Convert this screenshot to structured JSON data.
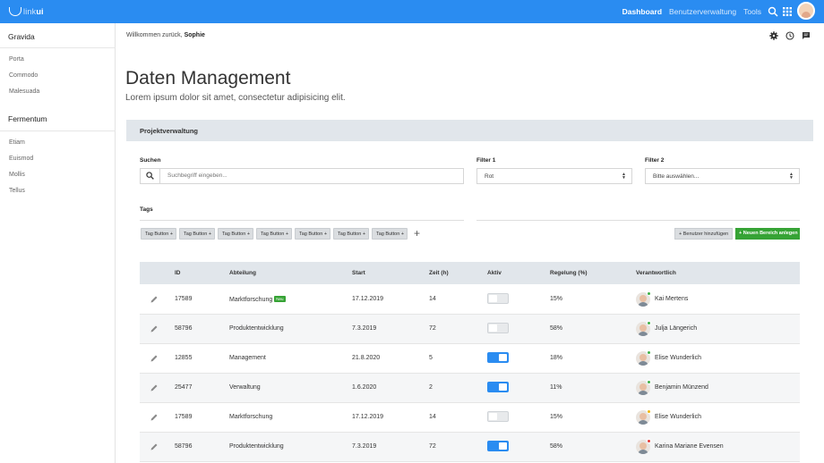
{
  "brand": {
    "prefix": "link",
    "suffix": "ui",
    "accent": "#2a8cf1"
  },
  "nav": {
    "dashboard": "Dashboard",
    "users": "Benutzerverwaltung",
    "tools": "Tools"
  },
  "sidebar": {
    "section1": "Gravida",
    "items1": [
      "Porta",
      "Commodo",
      "Malesuada"
    ],
    "section2": "Fermentum",
    "items2": [
      "Etiam",
      "Euismod",
      "Mollis",
      "Tellus"
    ]
  },
  "header": {
    "welcome": "Willkommen zurück,",
    "user": "Sophie"
  },
  "page": {
    "title": "Daten Management",
    "subtitle": "Lorem ipsum dolor sit amet, consectetur adipisicing elit."
  },
  "panel": {
    "title": "Projektverwaltung"
  },
  "filters": {
    "search_label": "Suchen",
    "search_placeholder": "Suchbegriff eingeben...",
    "filter1_label": "Filter 1",
    "filter1_value": "Rot",
    "filter2_label": "Filter 2",
    "filter2_value": "Bitte auswählen..."
  },
  "tags": {
    "label": "Tags",
    "items": [
      "Tag Button +",
      "Tag Button +",
      "Tag Button +",
      "Tag Button +",
      "Tag Button +",
      "Tag Button +",
      "Tag Button +"
    ],
    "add_user": "+ Benutzer hinzufügen",
    "new_area": "+ Neuen Bereich anlegen"
  },
  "table": {
    "headers": [
      "ID",
      "Abteilung",
      "Start",
      "Zeit (h)",
      "Aktiv",
      "Regelung (%)",
      "Verantwortlich"
    ],
    "badge_new": "Neu",
    "rows": [
      {
        "id": "17589",
        "dept": "Marktforschung",
        "start": "17.12.2019",
        "time": "14",
        "active": false,
        "reg": "15%",
        "person": "Kai Mertens",
        "status": "#3cb043"
      },
      {
        "id": "58796",
        "dept": "Produktentwicklung",
        "start": "7.3.2019",
        "time": "72",
        "active": false,
        "reg": "58%",
        "person": "Julja Längerich",
        "status": "#3cb043"
      },
      {
        "id": "12855",
        "dept": "Management",
        "start": "21.8.2020",
        "time": "5",
        "active": true,
        "reg": "18%",
        "person": "Elise Wunderlich",
        "status": "#3cb043"
      },
      {
        "id": "25477",
        "dept": "Verwaltung",
        "start": "1.6.2020",
        "time": "2",
        "active": true,
        "reg": "11%",
        "person": "Benjamin Münzend",
        "status": "#3cb043"
      },
      {
        "id": "17589",
        "dept": "Marktforschung",
        "start": "17.12.2019",
        "time": "14",
        "active": false,
        "reg": "15%",
        "person": "Elise Wunderlich",
        "status": "#f0b400"
      },
      {
        "id": "58796",
        "dept": "Produktentwicklung",
        "start": "7.3.2019",
        "time": "72",
        "active": true,
        "reg": "58%",
        "person": "Karina Mariane Evensen",
        "status": "#e53935"
      }
    ]
  }
}
